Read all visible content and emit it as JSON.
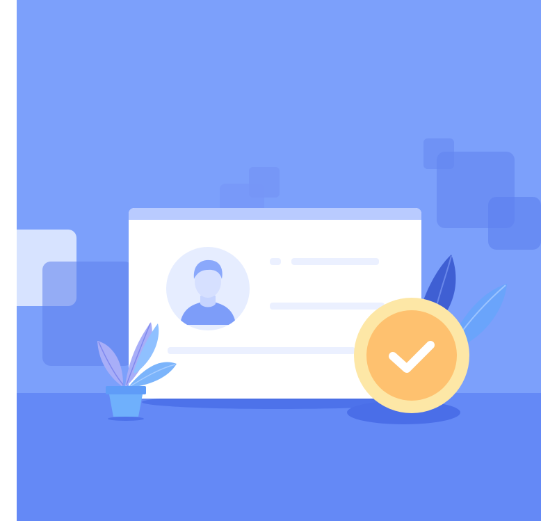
{
  "illustration": {
    "subject": "",
    "colors": {
      "sky": "#7ca0fb",
      "floor": "#6489f6",
      "card": "#ffffff",
      "card_header": "#b9cbff",
      "placeholder_line": "#ebf0ff",
      "avatar_bg": "#e6edff",
      "person": "#8aa8fb",
      "badge_ring": "#fde7a6",
      "badge_fill": "#fec16f",
      "check": "#ffffff",
      "leaf_dark": "#3f5fd3",
      "leaf_light": "#6aa4fb",
      "pot": "#63a3fb",
      "plant_leaves": "#a8aef8"
    },
    "icons": [
      "user-avatar-icon",
      "checkmark-icon",
      "leaf-icon",
      "potted-plant-icon"
    ]
  }
}
